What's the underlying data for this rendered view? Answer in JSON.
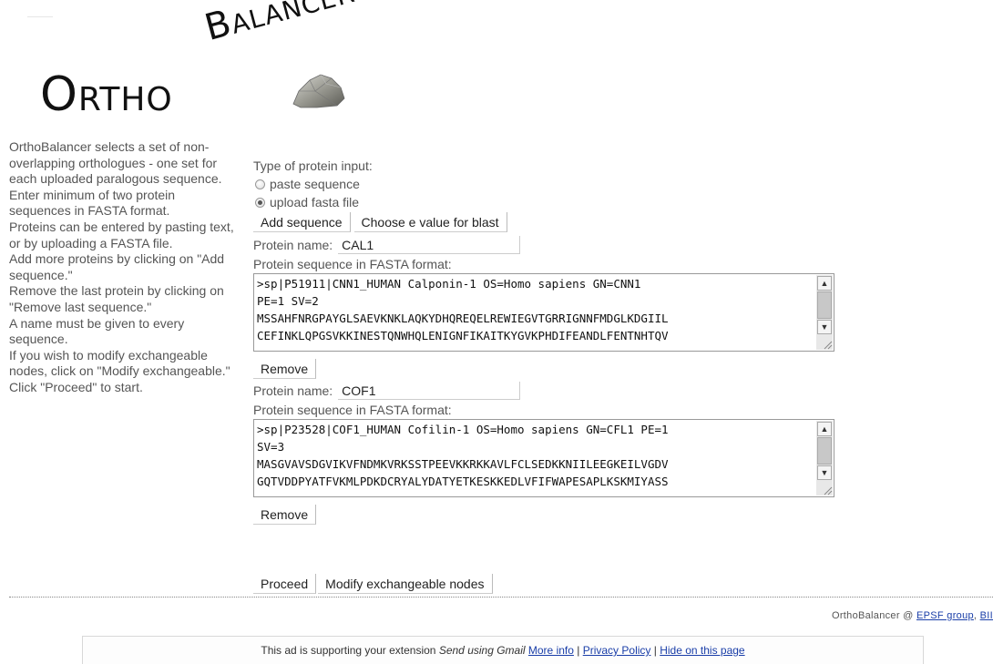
{
  "logo": {
    "word_ortho": "Ortho",
    "word_balancer": "Balancer"
  },
  "help_text": [
    "OrthoBalancer selects a set of non-overlapping orthologues - one set for each uploaded paralogous sequence.",
    "Enter minimum of two protein sequences in FASTA format.",
    "Proteins can be entered by pasting text, or by uploading a FASTA file.",
    "Add more proteins by clicking on \"Add sequence.\"",
    "Remove the last protein by clicking on \"Remove last sequence.\"",
    "A name must be given to every sequence.",
    "If you wish to modify exchangeable nodes, click on \"Modify exchangeable.\"",
    "Click \"Proceed\" to start."
  ],
  "input_type": {
    "label": "Type of protein input:",
    "options": [
      "paste sequence",
      "upload fasta file"
    ],
    "selected_index": 1
  },
  "buttons": {
    "add_sequence": "Add sequence",
    "choose_evalue": "Choose e value for blast",
    "remove": "Remove",
    "proceed": "Proceed",
    "modify_nodes": "Modify exchangeable nodes"
  },
  "proteins": [
    {
      "name_label": "Protein name:",
      "name_value": "CAL1",
      "fasta_label": "Protein sequence in FASTA format:",
      "lines": [
        ">sp|P51911|CNN1_HUMAN Calponin-1 OS=Homo sapiens GN=CNN1",
        "PE=1 SV=2",
        "MSSAHFNRGPAYGLSAEVKNKLAQKYDHQREQELREWIEGVTGRRIGNNFMDGLKDGIIL",
        "CEFINKLQPGSVKKINESTQNWHQLENIGNFIKAITKYGVKPHDIFEANDLFENTNHTQV"
      ]
    },
    {
      "name_label": "Protein name:",
      "name_value": "COF1",
      "fasta_label": "Protein sequence in FASTA format:",
      "lines": [
        ">sp|P23528|COF1_HUMAN Cofilin-1 OS=Homo sapiens GN=CFL1 PE=1",
        "SV=3",
        "MASGVAVSDGVIKVFNDMKVRKSSTPEEVKKRKKAVLFCLSEDKKNIILEEGKEILVGDV",
        "GQTVDDPYATFVKMLPDKDCRYALYDATYETKESKKEDLVFIFWAPESAPLKSKMIYASS"
      ]
    }
  ],
  "footer": {
    "prefix": "OrthoBalancer @ ",
    "link1": "EPSF group",
    "separator": ", ",
    "link2": "BII"
  },
  "ad": {
    "text_before": "This ad is supporting your extension ",
    "extension_name": "Send using Gmail",
    "link_more": "More info",
    "link_privacy": "Privacy Policy",
    "link_hide": "Hide on this page",
    "sep": " | "
  }
}
